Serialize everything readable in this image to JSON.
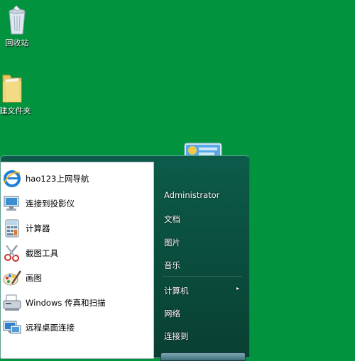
{
  "desktop": {
    "icons": [
      {
        "label": "回收站",
        "icon": "recycle-bin-icon"
      },
      {
        "label": "新建文件夹",
        "icon": "folder-icon"
      }
    ]
  },
  "start_menu": {
    "programs": [
      {
        "label": "hao123上网导航",
        "icon": "internet-explorer-icon"
      },
      {
        "label": "连接到投影仪",
        "icon": "projector-icon"
      },
      {
        "label": "计算器",
        "icon": "calculator-icon"
      },
      {
        "label": "截图工具",
        "icon": "scissors-icon"
      },
      {
        "label": "画图",
        "icon": "paint-icon"
      },
      {
        "label": "Windows 传真和扫描",
        "icon": "fax-scanner-icon"
      },
      {
        "label": "远程桌面连接",
        "icon": "remote-desktop-icon"
      }
    ],
    "right_items": [
      {
        "label": "Administrator"
      },
      {
        "label": "文档"
      },
      {
        "label": "图片"
      },
      {
        "label": "音乐"
      },
      {
        "label": "计算机",
        "arrow": "▸"
      },
      {
        "label": "网络"
      },
      {
        "label": "连接到"
      }
    ],
    "user_tile_icon": "control-panel-user-picture-icon",
    "shutdown_icon": "shutdown-button"
  }
}
